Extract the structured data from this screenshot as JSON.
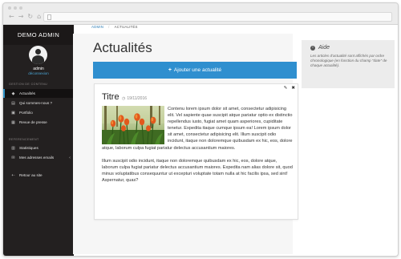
{
  "browser": {
    "nav_icons": [
      "back-arrow-icon",
      "forward-arrow-icon",
      "reload-icon",
      "home-icon"
    ],
    "url": ""
  },
  "sidebar": {
    "brand": "DEMO ADMIN",
    "user": {
      "name": "admin",
      "logout": "déconnexion"
    },
    "sections": [
      {
        "label": "GESTION DE CONTENU",
        "items": [
          {
            "label": "Actualités",
            "icon": "tag-icon",
            "active": true
          },
          {
            "label": "Qui sommes-nous ?",
            "icon": "document-icon",
            "active": false
          },
          {
            "label": "Portfolio",
            "icon": "image-icon",
            "active": false
          },
          {
            "label": "Revue de presse",
            "icon": "newspaper-icon",
            "active": false
          }
        ]
      },
      {
        "label": "REFERENCEMENT",
        "items": [
          {
            "label": "Statistiques",
            "icon": "chart-icon",
            "active": false
          },
          {
            "label": "Mes adresses emails",
            "icon": "email-icon",
            "active": false,
            "chevron": "‹"
          }
        ]
      }
    ],
    "back_to_site": {
      "label": "Retour au site",
      "icon": "arrow-left-icon"
    }
  },
  "breadcrumb": {
    "home": "ADMIN",
    "current": "ACTUALITÉS"
  },
  "page": {
    "title": "Actualités",
    "add_button": "Ajouter une actualité"
  },
  "article": {
    "title": "Titre",
    "date": "19/11/2016",
    "image_alt": "orange tulips photo",
    "paragraphs": [
      "Contenu lorem ipsum dolor sit amet, consectetur adipisicing elit. Vel sapiente quae suscipit atque pariatur optio ex distinctio repellendus iusto, fugiat amet quam asperiores, cupiditate tenetur. Expedita itaque cumque ipsum ea! Lorem ipsum dolor sit amet, consectetur adipisicing elit. Illum suscipit odio incidunt, itaque non doloremque quibusdam ex hic, eos, dolore atque, laborum culpa fugiat pariatur delectus accusantium maiores.",
      "Illum suscipit odio incidunt, itaque non doloremque quibusdam ex hic, eos, dolore atque, laborum culpa fugiat pariatur delectus accusantium maiores. Expedita nam alias dolore sit, quod minus voluptatibus consequuntur ut excepturi voluptate totam nulla at hic facilis ipsa, sed sint! Aspernatur, quas?"
    ]
  },
  "help": {
    "title": "Aide",
    "text": "Les articles d'actualité sont affichés par ordre chronologique (en fonction du champ \"date\" de chaque actualité)."
  },
  "colors": {
    "sidebar_bg": "#232020",
    "accent": "#2f8fcf",
    "active_marker": "#2e93c7",
    "link": "#4aa6d6"
  }
}
